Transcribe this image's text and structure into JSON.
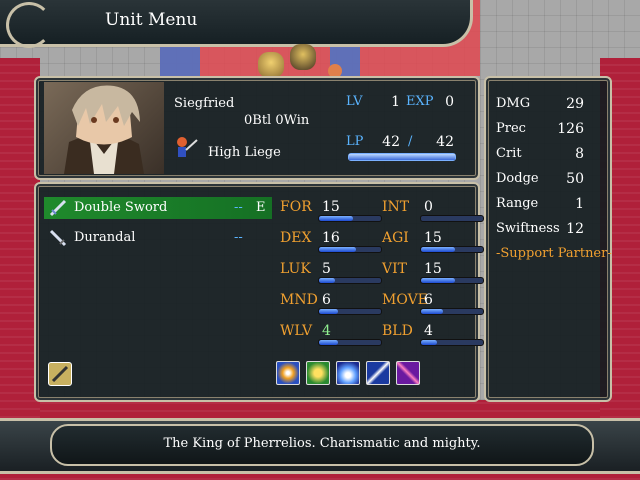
{
  "header": {
    "title": "Unit Menu"
  },
  "unit": {
    "name": "Siegfried",
    "record": "0Btl 0Win",
    "class": "High Liege",
    "lv_label": "LV",
    "lv": "1",
    "exp_label": "EXP",
    "exp": "0",
    "lp_label": "LP",
    "lp_current": "42",
    "lp_sep": "/",
    "lp_max": "42",
    "lp_fraction": 1.0
  },
  "items": [
    {
      "name": "Double Sword",
      "uses": "--",
      "equip": "E",
      "icon": "sword-icon"
    },
    {
      "name": "Durandal",
      "uses": "--",
      "equip": "",
      "icon": "sword-icon"
    }
  ],
  "stats_left": [
    {
      "label": "FOR",
      "value": "15",
      "fill": 0.55
    },
    {
      "label": "DEX",
      "value": "16",
      "fill": 0.6
    },
    {
      "label": "LUK",
      "value": "5",
      "fill": 0.25
    },
    {
      "label": "MND",
      "value": "6",
      "fill": 0.3
    },
    {
      "label": "WLV",
      "value": "4",
      "fill": 0.3
    }
  ],
  "stats_right": [
    {
      "label": "INT",
      "value": "0",
      "fill": 0.0
    },
    {
      "label": "AGI",
      "value": "15",
      "fill": 0.55
    },
    {
      "label": "VIT",
      "value": "15",
      "fill": 0.55
    },
    {
      "label": "MOVE",
      "value": "6",
      "fill": 0.35
    },
    {
      "label": "BLD",
      "value": "4",
      "fill": 0.25
    }
  ],
  "combat": [
    {
      "label": "DMG",
      "value": "29"
    },
    {
      "label": "Prec",
      "value": "126"
    },
    {
      "label": "Crit",
      "value": "8"
    },
    {
      "label": "Dodge",
      "value": "50"
    },
    {
      "label": "Range",
      "value": "1"
    },
    {
      "label": "Swiftness",
      "value": "12"
    }
  ],
  "support_label": "-Support Partner-",
  "description": "The King of Pherrelios. Charismatic and mighty.",
  "skills": [
    "burst-skill-icon",
    "crown-skill-icon",
    "blade-skill-icon",
    "sword-skill-icon",
    "slash-skill-icon"
  ],
  "colors": {
    "accent_blue": "#5ab4ff",
    "accent_orange": "#f0a030",
    "equip_highlight": "#1f8a2c"
  }
}
